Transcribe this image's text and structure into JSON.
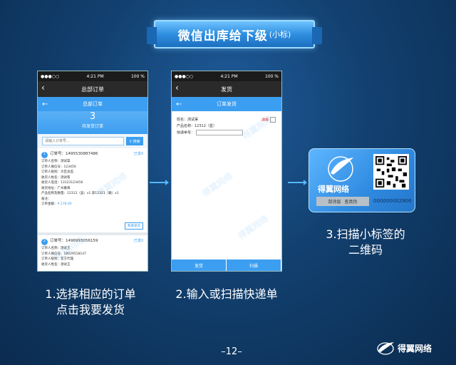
{
  "slide": {
    "title_main": "微信出库给下级",
    "title_sub": "(小标)",
    "page_number": "–12–",
    "brand_name": "得翼网络"
  },
  "status_bar": {
    "carrier": "●●●○○",
    "time": "4:21 PM",
    "battery": "100 %"
  },
  "screen1": {
    "nav_title": "总部订单",
    "sub_title": "总部订单",
    "pending_count": "3",
    "pending_label": "待发货订单",
    "search_placeholder": "请输入订单号...",
    "search_button": "搜索",
    "orders": [
      {
        "index": "1",
        "order_no": "订单号：1495530887486",
        "status": "已发0",
        "lines": [
          "订单人名称：测试渠",
          "订单人微信号：123456",
          "订单人级别：大区总监",
          "收货人姓名：测试帮",
          "收货人电话：13123123456",
          "收货地址：广州番禺",
          "产品名称及数量：12312（盒）x1 第12321（箱）x1",
          "备注："
        ],
        "amount_label": "订单金额：",
        "amount": "¥:178.00",
        "ship_button": "我要发货"
      },
      {
        "index": "2",
        "order_no": "订单号：1496993056159",
        "status": "已发0",
        "lines": [
          "订单人名称：测试王",
          "订单人微信号：18029518147",
          "订单人级别：官方代理",
          "收货人姓名：测试王"
        ]
      }
    ]
  },
  "screen2": {
    "nav_title": "发货",
    "sub_title": "订单发货",
    "name_line": "姓名：测试渠",
    "product_line": "产品名称：12312（盒）",
    "tracking_label": "快递单号：",
    "urgent_label": "通报",
    "ship_button": "发货",
    "scan_button": "扫描"
  },
  "label_card": {
    "brand": "得翼网络",
    "scratch_a": "刮涂层",
    "scratch_b": "查真伪",
    "serial": "000000002906"
  },
  "watermark": "得翼网络",
  "captions": {
    "step1_line1": "1.选择相应的订单",
    "step1_line2": "点击我要发货",
    "step2": "2.输入或扫描快递单",
    "step3_line1": "3.扫描小标签的",
    "step3_line2": "二维码"
  },
  "colors": {
    "accent": "#3c9ef0",
    "background": "#12406f",
    "urgent": "#e03030"
  }
}
